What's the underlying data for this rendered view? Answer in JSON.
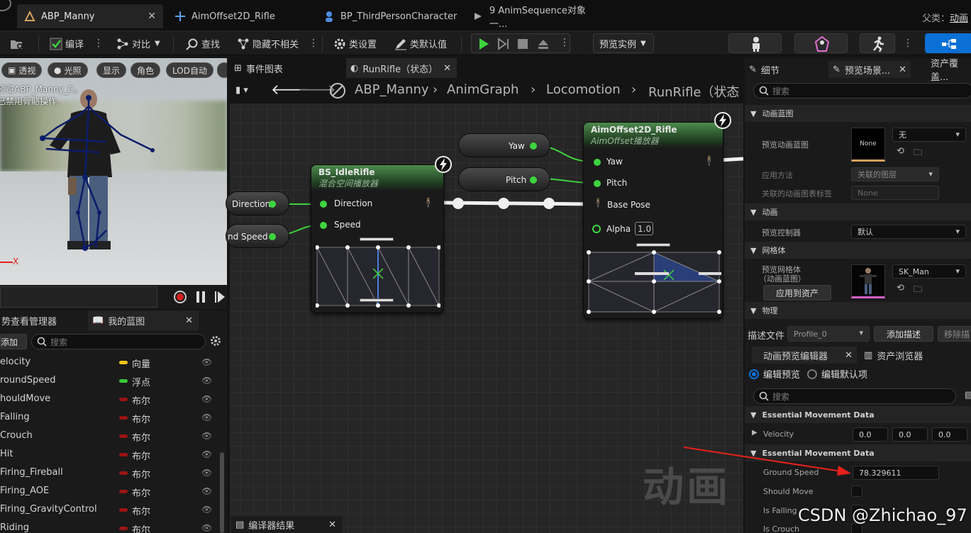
{
  "tabs": [
    {
      "label": "ABP_Manny",
      "icon": "anim-blueprint-icon"
    },
    {
      "label": "AimOffset2D_Rifle",
      "icon": "aim-offset-icon"
    },
    {
      "label": "BP_ThirdPersonCharacter",
      "icon": "character-icon"
    },
    {
      "label": "9 AnimSequence对象一...",
      "icon": "anim-sequence-icon"
    }
  ],
  "parent_class": {
    "label": "父类：",
    "value": "动画"
  },
  "toolbar": {
    "compile": "编译",
    "diff": "对比",
    "find": "查找",
    "hide_unrelated": "隐藏不相关",
    "class_settings": "类设置",
    "class_defaults": "类默认值",
    "preview_instance": "预览实例"
  },
  "viewport": {
    "buttons": [
      "透视",
      "光照",
      "显示",
      "角色",
      "LOD自动"
    ],
    "overlay_line1": "预览ABP_Manny_C。",
    "overlay_line2": "已禁用骨骼操作。",
    "axis_label": "X"
  },
  "left_panel": {
    "tab1": "势查看管理器",
    "tab2": "我的蓝图",
    "add_label": "添加",
    "search_placeholder": "搜索",
    "variables": [
      {
        "name": "elocity",
        "type": "向量",
        "color": "#f0c419"
      },
      {
        "name": "roundSpeed",
        "type": "浮点",
        "color": "#37c837"
      },
      {
        "name": "houldMove",
        "type": "布尔",
        "color": "#9b1414"
      },
      {
        "name": "Falling",
        "type": "布尔",
        "color": "#9b1414"
      },
      {
        "name": "Crouch",
        "type": "布尔",
        "color": "#9b1414"
      },
      {
        "name": "Hit",
        "type": "布尔",
        "color": "#9b1414"
      },
      {
        "name": "Firing_Fireball",
        "type": "布尔",
        "color": "#9b1414"
      },
      {
        "name": "Firing_AOE",
        "type": "布尔",
        "color": "#9b1414"
      },
      {
        "name": "Firing_GravityControl",
        "type": "布尔",
        "color": "#9b1414"
      },
      {
        "name": "Riding",
        "type": "布尔",
        "color": "#9b1414"
      }
    ]
  },
  "graph": {
    "tab_events": "事件图表",
    "tab_state": "RunRifle（状态）",
    "breadcrumb": [
      "ABP_Manny",
      "AnimGraph",
      "Locomotion",
      "RunRifle（状态"
    ],
    "watermark": "动画",
    "bottom_tab": "编译器结果",
    "var_nodes": {
      "direction": "Direction",
      "ground_speed": "nd Speed",
      "yaw": "Yaw",
      "pitch": "Pitch"
    },
    "blendspace_node": {
      "title": "BS_IdleRifle",
      "subtitle": "混合空间播放器",
      "pins": [
        "Direction",
        "Speed"
      ]
    },
    "aimoffset_node": {
      "title": "AimOffset2D_Rifle",
      "subtitle": "AimOffset播放器",
      "pins": [
        "Yaw",
        "Pitch",
        "Base Pose",
        "Alpha"
      ],
      "alpha_value": "1.0"
    }
  },
  "right_panel": {
    "tabs": [
      "细节",
      "预览场景...",
      "资产覆盖..."
    ],
    "search_placeholder": "搜索",
    "sections": {
      "anim_bp": "动画蓝图",
      "animation": "动画",
      "mesh": "网格体",
      "physics": "物理"
    },
    "props": {
      "preview_anim_bp": "预览动画蓝图",
      "preview_anim_bp_value": "无",
      "none_thumb": "None",
      "apply_method": "应用方法",
      "apply_method_value": "关联的图层",
      "linked_tag": "关联的动画图表标签",
      "linked_tag_value": "None",
      "preview_controller": "预览控制器",
      "preview_controller_value": "默认",
      "preview_mesh_line1": "预览网格体",
      "preview_mesh_line2": "（动画蓝图）",
      "preview_mesh_value": "SK_Man",
      "apply_to_asset": "应用到资产"
    },
    "profile": {
      "label": "描述文件",
      "value": "Profile_0",
      "add": "添加描述",
      "remove": "移除描"
    },
    "editor_tabs": [
      "动画预览编辑器",
      "资产浏览器"
    ],
    "radio": {
      "edit_preview": "编辑预览",
      "edit_defaults": "编辑默认项"
    },
    "search2_placeholder": "搜索",
    "emd1": "Essential Movement Data",
    "velocity_label": "Velocity",
    "velocity_values": [
      "0.0",
      "0.0",
      "0.0"
    ],
    "emd2": "Essential Movement Data",
    "ground_speed_label": "Ground Speed",
    "ground_speed_value": "78.329611",
    "should_move": "Should Move",
    "is_falling": "Is Falling",
    "is_crouch": "Is Crouch",
    "csdn": "CSDN @Zhichao_97"
  },
  "colors": {
    "accent": "#0a70d6",
    "exec_green": "#3ed43e",
    "annotation_red": "#e8201a"
  }
}
